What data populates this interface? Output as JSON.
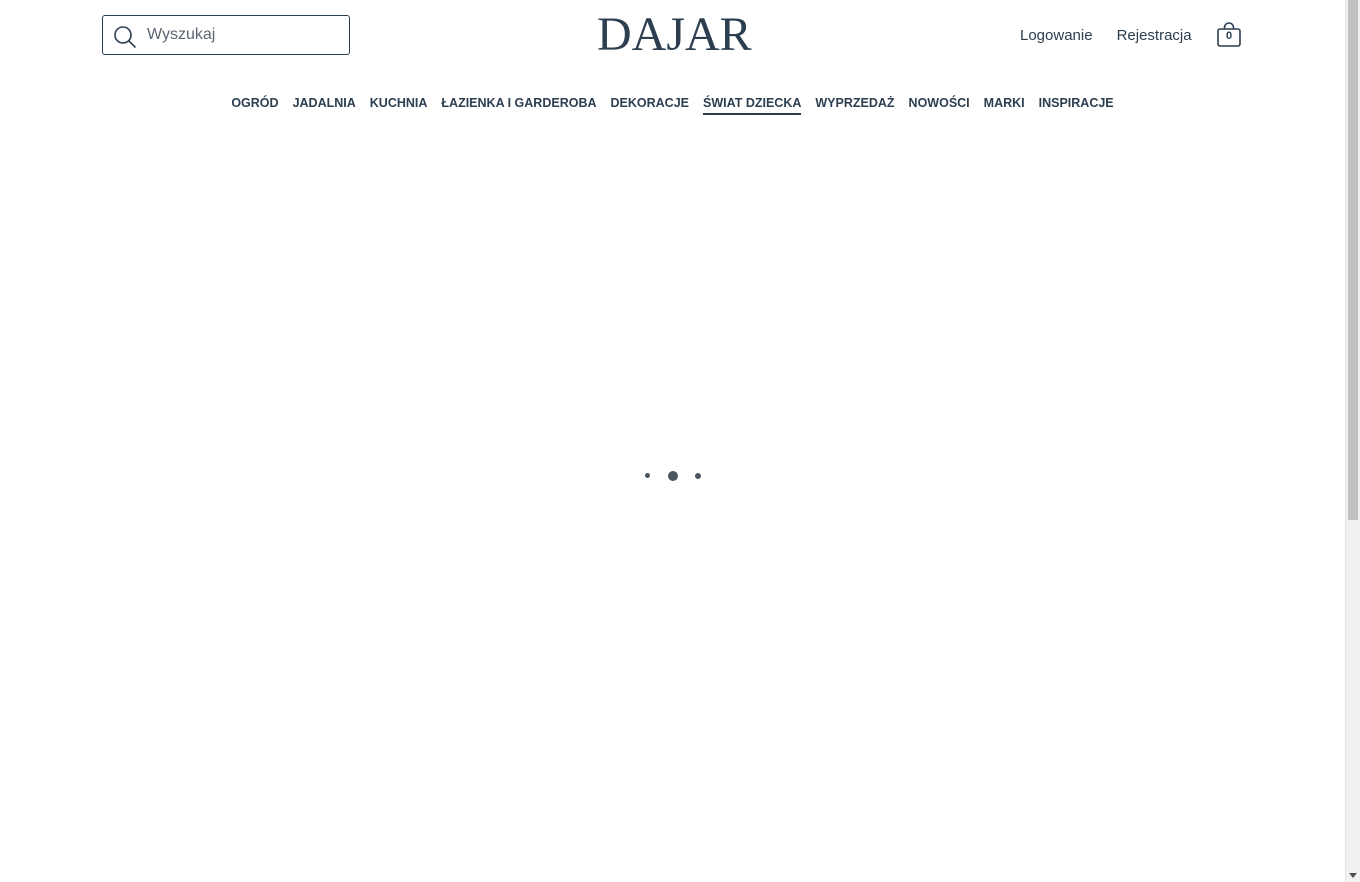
{
  "header": {
    "search": {
      "placeholder": "Wyszukaj",
      "value": "",
      "icon": "search-icon"
    },
    "logo_text": "DAJAR",
    "account": {
      "login_label": "Logowanie",
      "register_label": "Rejestracja"
    },
    "cart": {
      "icon": "shopping-bag-icon",
      "count": "0"
    }
  },
  "nav": {
    "items": [
      {
        "label": "OGRÓD"
      },
      {
        "label": "JADALNIA"
      },
      {
        "label": "KUCHNIA"
      },
      {
        "label": "ŁAZIENKA I GARDEROBA"
      },
      {
        "label": "DEKORACJE"
      },
      {
        "label": "ŚWIAT DZIECKA"
      },
      {
        "label": "WYPRZEDAŻ"
      },
      {
        "label": "NOWOŚCI"
      },
      {
        "label": "MARKI"
      },
      {
        "label": "INSPIRACJE"
      }
    ],
    "active_index": 5
  },
  "main": {
    "loading_indicator": "three-dot-loader"
  },
  "colors": {
    "text": "#2c3e50",
    "background": "#ffffff",
    "loader_dot": "#4a5560"
  }
}
